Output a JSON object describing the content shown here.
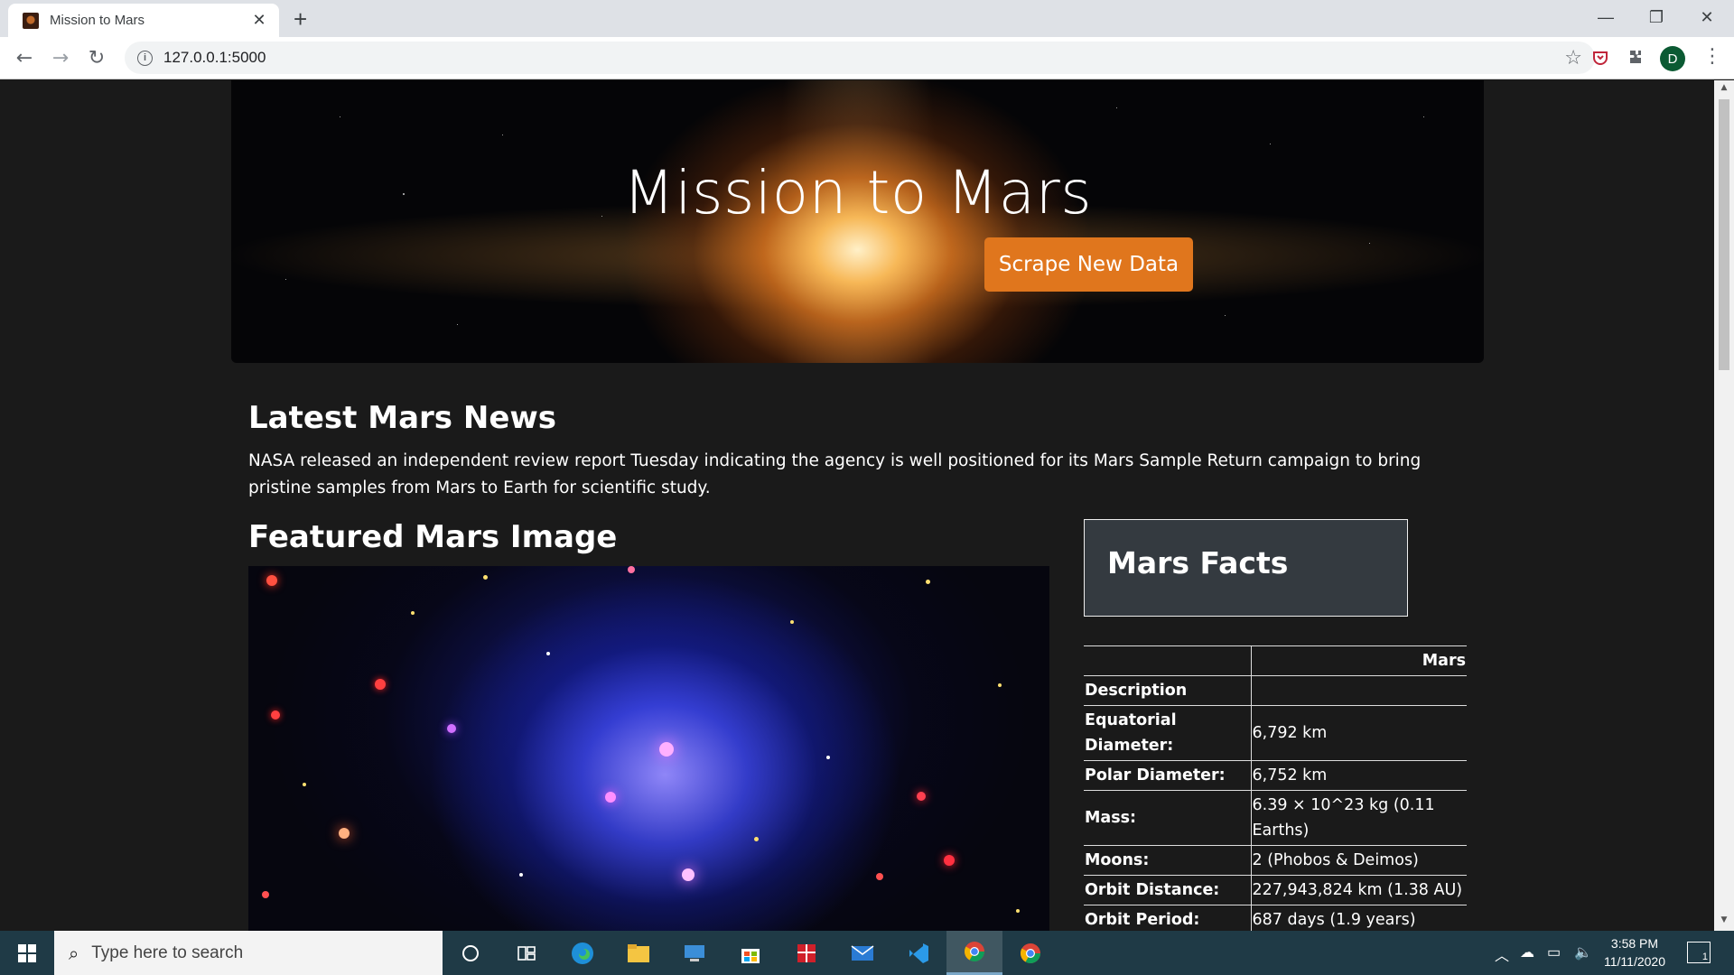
{
  "browser": {
    "tab_title": "Mission to Mars",
    "url": "127.0.0.1:5000",
    "profile_initial": "D"
  },
  "page": {
    "hero": {
      "title": "Mission to Mars",
      "button_label": "Scrape New Data"
    },
    "news": {
      "heading": "Latest Mars News",
      "paragraph": "NASA released an independent review report Tuesday indicating the agency is well positioned for its Mars Sample Return campaign to bring pristine samples from Mars to Earth for scientific study."
    },
    "featured": {
      "heading": "Featured Mars Image"
    },
    "facts": {
      "heading": "Mars Facts",
      "column_header": "Mars",
      "rows": [
        {
          "label": "Description",
          "value": ""
        },
        {
          "label": "Equatorial Diameter:",
          "value": "6,792 km"
        },
        {
          "label": "Polar Diameter:",
          "value": "6,752 km"
        },
        {
          "label": "Mass:",
          "value": "6.39 × 10^23 kg (0.11 Earths)"
        },
        {
          "label": "Moons:",
          "value": "2 (Phobos & Deimos)"
        },
        {
          "label": "Orbit Distance:",
          "value": "227,943,824 km (1.38 AU)"
        },
        {
          "label": "Orbit Period:",
          "value": "687 days (1.9 years)"
        }
      ]
    },
    "colors": {
      "accent_button": "#e0761d",
      "facts_box_bg": "#343a40",
      "page_bg": "#1a1a1a"
    }
  },
  "taskbar": {
    "search_placeholder": "Type here to search",
    "time": "3:58 PM",
    "date": "11/11/2020",
    "notification_count": "1",
    "pinned_icons": [
      "cortana-icon",
      "task-view-icon",
      "edge-icon",
      "file-explorer-icon",
      "remote-desktop-icon",
      "store-icon",
      "gift-icon",
      "mail-icon",
      "vscode-icon",
      "chrome-icon",
      "chrome-icon"
    ]
  }
}
